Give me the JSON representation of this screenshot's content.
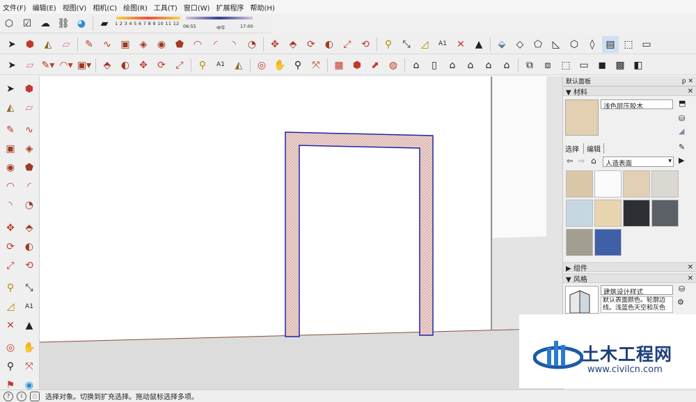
{
  "menu": [
    "文件(F)",
    "编辑(E)",
    "视图(V)",
    "相机(C)",
    "绘图(R)",
    "工具(T)",
    "窗口(W)",
    "扩展程序",
    "帮助(H)"
  ],
  "shadow": {
    "months": "1 2 3 4 5 6 7 8 9 10 11 12",
    "time_start": "06:55",
    "time_mid": "中午",
    "time_end": "17:00"
  },
  "panel": {
    "title": "默认面板",
    "materials_header": "材料",
    "material_name": "浅色层压胶木",
    "tab_select": "选择",
    "tab_edit": "编辑",
    "collection": "人造表面",
    "components_header": "组件",
    "styles_header": "风格",
    "style_name": "建筑设计样式",
    "style_desc": "默认表面颜色。轮廓边线。浅蓝色天空和灰色"
  },
  "swatch_colors": [
    "#d9c7a8",
    "#fbfbfb",
    "#e2d0b5",
    "#dbd8d2",
    "#c7d7e2",
    "#e9d4b0",
    "#2c3035",
    "#5a6066",
    "#a29e92",
    "#3f5fa6"
  ],
  "status": {
    "message": "选择对象。切换到扩充选择。拖动鼠标选择多项。"
  },
  "watermark": {
    "title": "土木工程网",
    "url": "www.civilcn.com"
  }
}
